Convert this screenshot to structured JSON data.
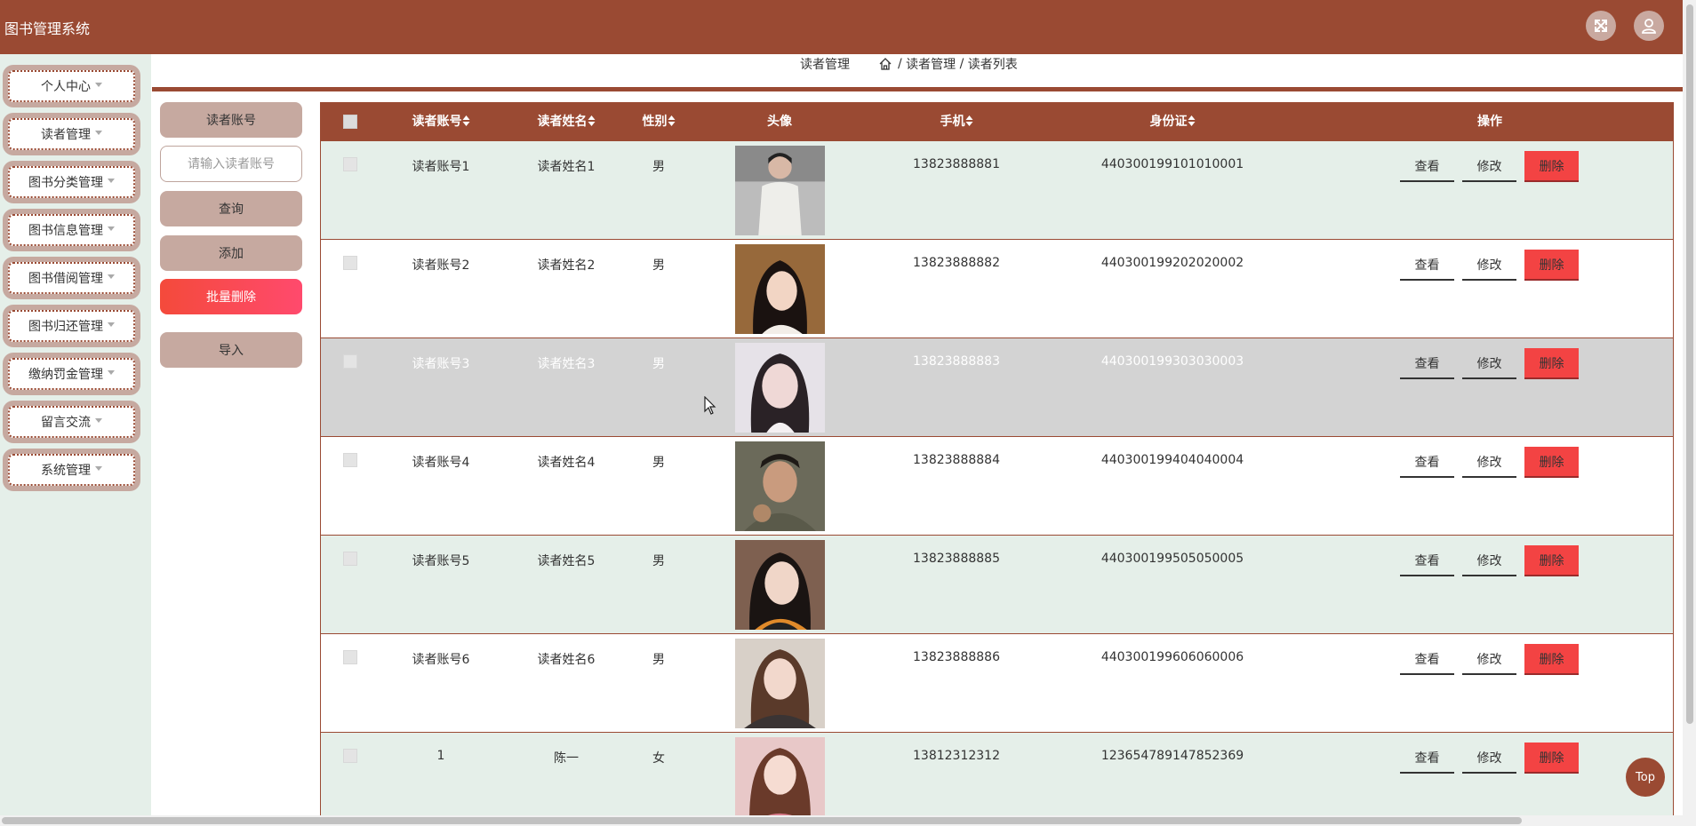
{
  "app": {
    "title": "图书管理系统"
  },
  "header": {
    "fullscreen_icon": "fullscreen-icon",
    "user_icon": "user-icon"
  },
  "sidebar": {
    "items": [
      {
        "label": "个人中心"
      },
      {
        "label": "读者管理"
      },
      {
        "label": "图书分类管理"
      },
      {
        "label": "图书信息管理"
      },
      {
        "label": "图书借阅管理"
      },
      {
        "label": "图书归还管理"
      },
      {
        "label": "缴纳罚金管理"
      },
      {
        "label": "留言交流"
      },
      {
        "label": "系统管理"
      }
    ]
  },
  "breadcrumb": {
    "page": "读者管理",
    "path1": "读者管理",
    "sep": "/",
    "path2": "读者列表"
  },
  "search": {
    "field_label": "读者账号",
    "placeholder": "请输入读者账号",
    "query_label": "查询",
    "add_label": "添加",
    "batch_delete_label": "批量删除",
    "import_label": "导入"
  },
  "table": {
    "columns": {
      "account": "读者账号",
      "name": "读者姓名",
      "gender": "性别",
      "avatar": "头像",
      "phone": "手机",
      "idcard": "身份证",
      "actions": "操作"
    },
    "actions": {
      "view": "查看",
      "edit": "修改",
      "delete": "删除"
    },
    "rows": [
      {
        "account": "读者账号1",
        "name": "读者姓名1",
        "gender": "男",
        "phone": "13823888881",
        "idcard": "440300199101010001"
      },
      {
        "account": "读者账号2",
        "name": "读者姓名2",
        "gender": "男",
        "phone": "13823888882",
        "idcard": "440300199202020002"
      },
      {
        "account": "读者账号3",
        "name": "读者姓名3",
        "gender": "男",
        "phone": "13823888883",
        "idcard": "440300199303030003"
      },
      {
        "account": "读者账号4",
        "name": "读者姓名4",
        "gender": "男",
        "phone": "13823888884",
        "idcard": "440300199404040004"
      },
      {
        "account": "读者账号5",
        "name": "读者姓名5",
        "gender": "男",
        "phone": "13823888885",
        "idcard": "440300199505050005"
      },
      {
        "account": "读者账号6",
        "name": "读者姓名6",
        "gender": "男",
        "phone": "13823888886",
        "idcard": "440300199606060006"
      },
      {
        "account": "1",
        "name": "陈一",
        "gender": "女",
        "phone": "13812312312",
        "idcard": "123654789147852369"
      }
    ]
  },
  "top_button": {
    "label": "Top"
  },
  "colors": {
    "brand": "#9a4a33",
    "row_alt": "#e5efe9",
    "row_hover": "#d3d3d3",
    "delete": "#f34343"
  }
}
